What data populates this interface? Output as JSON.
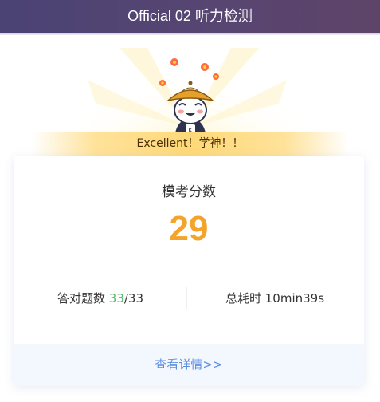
{
  "header": {
    "title": "Official 02 听力检测"
  },
  "hero": {
    "banner_text": "Excellent！学神！！"
  },
  "result": {
    "title": "模考分数",
    "score": "29",
    "correct_label": "答对题数",
    "correct_count": "33",
    "total_separator_total": "/33",
    "time_label": "总耗时",
    "time_value": "10min39s"
  },
  "footer": {
    "details_link": "查看详情>>"
  },
  "colors": {
    "header": "#524570",
    "score": "#f4a32b",
    "correct": "#59b86a",
    "link": "#5b8de0",
    "ribbon": "#ffd978"
  },
  "icons": {
    "mascot": "scholar-mascot-icon",
    "flowers": "flower-icon"
  }
}
